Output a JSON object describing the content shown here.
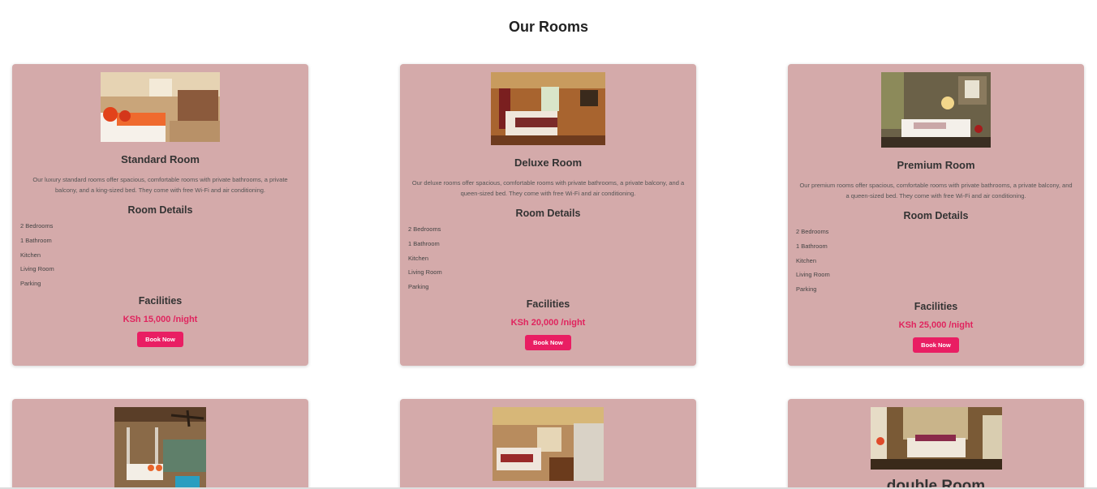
{
  "page": {
    "title": "Our Rooms"
  },
  "rooms": [
    {
      "title": "Standard Room",
      "description": "Our luxury standard rooms offer spacious, comfortable rooms with private bathrooms, a private balcony, and a king-sized bed. They come with free Wi-Fi and air conditioning.",
      "details_heading": "Room Details",
      "details": [
        "2 Bedrooms",
        "1 Bathroom",
        "Kitchen",
        "Living Room",
        "Parking"
      ],
      "facilities_heading": "Facilities",
      "price": "KSh 15,000 /night",
      "button": "Book Now"
    },
    {
      "title": "Deluxe Room",
      "description": "Our deluxe rooms offer spacious, comfortable rooms with private bathrooms, a private balcony, and a queen-sized bed. They come with free Wi-Fi and air conditioning.",
      "details_heading": "Room Details",
      "details": [
        "2 Bedrooms",
        "1 Bathroom",
        "Kitchen",
        "Living Room",
        "Parking"
      ],
      "facilities_heading": "Facilities",
      "price": "KSh 20,000 /night",
      "button": "Book Now"
    },
    {
      "title": "Premium Room",
      "description": "Our premium rooms offer spacious, comfortable rooms with private bathrooms, a private balcony, and a queen-sized bed. They come with free Wi-Fi and air conditioning.",
      "details_heading": "Room Details",
      "details": [
        "2 Bedrooms",
        "1 Bathroom",
        "Kitchen",
        "Living Room",
        "Parking"
      ],
      "facilities_heading": "Facilities",
      "price": "KSh 25,000 /night",
      "button": "Book Now"
    },
    {
      "title": ""
    },
    {
      "title": ""
    },
    {
      "title": "double Room"
    }
  ],
  "colors": {
    "card": "#d4aaaa",
    "accent": "#e91e63",
    "price": "#e0245e"
  }
}
